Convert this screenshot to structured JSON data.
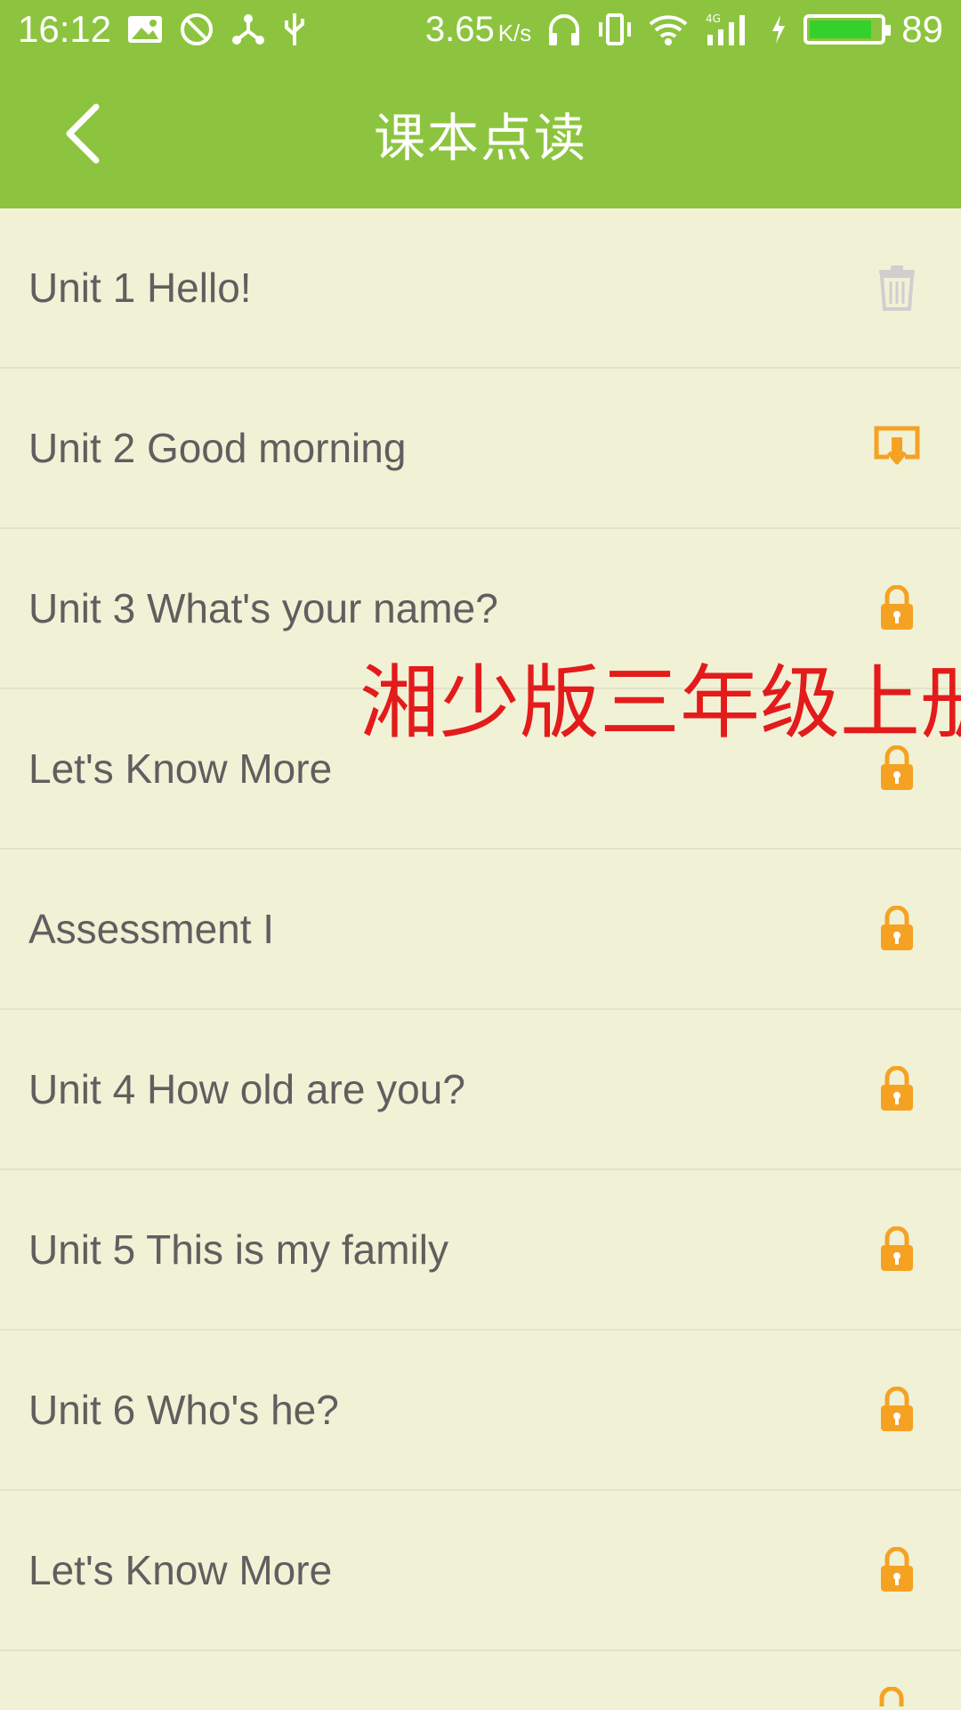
{
  "status_bar": {
    "time": "16:12",
    "speed": "3.65",
    "speed_unit": "K/s",
    "battery_level": "89",
    "battery_fraction": 0.89
  },
  "app_bar": {
    "title": "课本点读"
  },
  "colors": {
    "primary_green": "#8dc43f",
    "background": "#f1f1d6",
    "lock_orange": "#f5a223",
    "download_orange": "#f5a223",
    "trash_gray": "#cfcfcf",
    "overlay_red": "#e31b1b"
  },
  "lessons": [
    {
      "label": "Unit 1 Hello!",
      "action_icon": "trash-icon"
    },
    {
      "label": "Unit 2 Good morning",
      "action_icon": "download-icon"
    },
    {
      "label": "Unit 3 What's your name?",
      "action_icon": "lock-icon"
    },
    {
      "label": "Let's Know More",
      "action_icon": "lock-icon"
    },
    {
      "label": "Assessment I",
      "action_icon": "lock-icon"
    },
    {
      "label": "Unit 4 How old are you?",
      "action_icon": "lock-icon"
    },
    {
      "label": "Unit 5 This is my family",
      "action_icon": "lock-icon"
    },
    {
      "label": "Unit 6 Who's he?",
      "action_icon": "lock-icon"
    },
    {
      "label": "Let's Know More",
      "action_icon": "lock-icon"
    }
  ],
  "overlay_text": "湘少版三年级上册"
}
